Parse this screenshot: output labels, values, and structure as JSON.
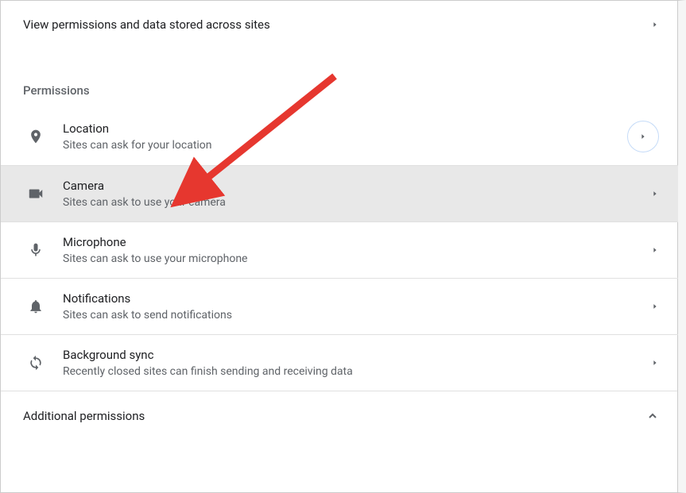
{
  "top_link": {
    "label": "View permissions and data stored across sites"
  },
  "section_title": "Permissions",
  "permissions": [
    {
      "label": "Location",
      "description": "Sites can ask for your location",
      "circled": true,
      "highlighted": false
    },
    {
      "label": "Camera",
      "description": "Sites can ask to use your camera",
      "circled": false,
      "highlighted": true
    },
    {
      "label": "Microphone",
      "description": "Sites can ask to use your microphone",
      "circled": false,
      "highlighted": false
    },
    {
      "label": "Notifications",
      "description": "Sites can ask to send notifications",
      "circled": false,
      "highlighted": false
    },
    {
      "label": "Background sync",
      "description": "Recently closed sites can finish sending and receiving data",
      "circled": false,
      "highlighted": false
    }
  ],
  "additional_permissions": {
    "label": "Additional permissions"
  }
}
